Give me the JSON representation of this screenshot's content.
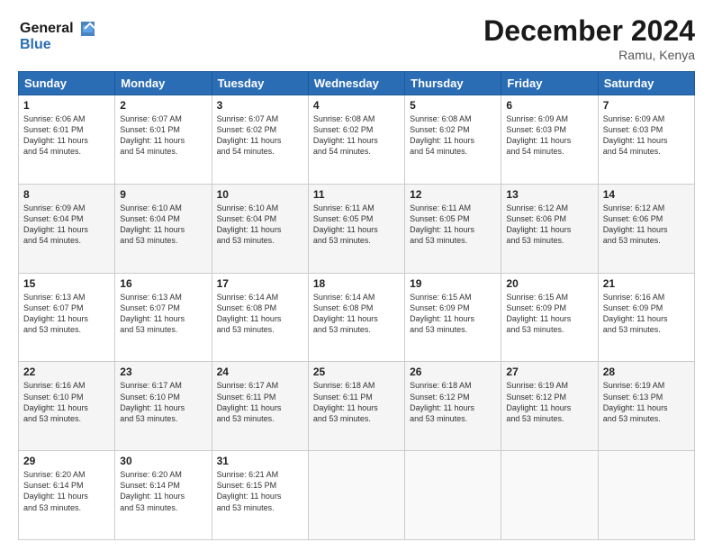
{
  "logo": {
    "line1": "General",
    "line2": "Blue"
  },
  "title": "December 2024",
  "location": "Ramu, Kenya",
  "days_of_week": [
    "Sunday",
    "Monday",
    "Tuesday",
    "Wednesday",
    "Thursday",
    "Friday",
    "Saturday"
  ],
  "weeks": [
    [
      {
        "day": "1",
        "info": "Sunrise: 6:06 AM\nSunset: 6:01 PM\nDaylight: 11 hours\nand 54 minutes."
      },
      {
        "day": "2",
        "info": "Sunrise: 6:07 AM\nSunset: 6:01 PM\nDaylight: 11 hours\nand 54 minutes."
      },
      {
        "day": "3",
        "info": "Sunrise: 6:07 AM\nSunset: 6:02 PM\nDaylight: 11 hours\nand 54 minutes."
      },
      {
        "day": "4",
        "info": "Sunrise: 6:08 AM\nSunset: 6:02 PM\nDaylight: 11 hours\nand 54 minutes."
      },
      {
        "day": "5",
        "info": "Sunrise: 6:08 AM\nSunset: 6:02 PM\nDaylight: 11 hours\nand 54 minutes."
      },
      {
        "day": "6",
        "info": "Sunrise: 6:09 AM\nSunset: 6:03 PM\nDaylight: 11 hours\nand 54 minutes."
      },
      {
        "day": "7",
        "info": "Sunrise: 6:09 AM\nSunset: 6:03 PM\nDaylight: 11 hours\nand 54 minutes."
      }
    ],
    [
      {
        "day": "8",
        "info": "Sunrise: 6:09 AM\nSunset: 6:04 PM\nDaylight: 11 hours\nand 54 minutes."
      },
      {
        "day": "9",
        "info": "Sunrise: 6:10 AM\nSunset: 6:04 PM\nDaylight: 11 hours\nand 53 minutes."
      },
      {
        "day": "10",
        "info": "Sunrise: 6:10 AM\nSunset: 6:04 PM\nDaylight: 11 hours\nand 53 minutes."
      },
      {
        "day": "11",
        "info": "Sunrise: 6:11 AM\nSunset: 6:05 PM\nDaylight: 11 hours\nand 53 minutes."
      },
      {
        "day": "12",
        "info": "Sunrise: 6:11 AM\nSunset: 6:05 PM\nDaylight: 11 hours\nand 53 minutes."
      },
      {
        "day": "13",
        "info": "Sunrise: 6:12 AM\nSunset: 6:06 PM\nDaylight: 11 hours\nand 53 minutes."
      },
      {
        "day": "14",
        "info": "Sunrise: 6:12 AM\nSunset: 6:06 PM\nDaylight: 11 hours\nand 53 minutes."
      }
    ],
    [
      {
        "day": "15",
        "info": "Sunrise: 6:13 AM\nSunset: 6:07 PM\nDaylight: 11 hours\nand 53 minutes."
      },
      {
        "day": "16",
        "info": "Sunrise: 6:13 AM\nSunset: 6:07 PM\nDaylight: 11 hours\nand 53 minutes."
      },
      {
        "day": "17",
        "info": "Sunrise: 6:14 AM\nSunset: 6:08 PM\nDaylight: 11 hours\nand 53 minutes."
      },
      {
        "day": "18",
        "info": "Sunrise: 6:14 AM\nSunset: 6:08 PM\nDaylight: 11 hours\nand 53 minutes."
      },
      {
        "day": "19",
        "info": "Sunrise: 6:15 AM\nSunset: 6:09 PM\nDaylight: 11 hours\nand 53 minutes."
      },
      {
        "day": "20",
        "info": "Sunrise: 6:15 AM\nSunset: 6:09 PM\nDaylight: 11 hours\nand 53 minutes."
      },
      {
        "day": "21",
        "info": "Sunrise: 6:16 AM\nSunset: 6:09 PM\nDaylight: 11 hours\nand 53 minutes."
      }
    ],
    [
      {
        "day": "22",
        "info": "Sunrise: 6:16 AM\nSunset: 6:10 PM\nDaylight: 11 hours\nand 53 minutes."
      },
      {
        "day": "23",
        "info": "Sunrise: 6:17 AM\nSunset: 6:10 PM\nDaylight: 11 hours\nand 53 minutes."
      },
      {
        "day": "24",
        "info": "Sunrise: 6:17 AM\nSunset: 6:11 PM\nDaylight: 11 hours\nand 53 minutes."
      },
      {
        "day": "25",
        "info": "Sunrise: 6:18 AM\nSunset: 6:11 PM\nDaylight: 11 hours\nand 53 minutes."
      },
      {
        "day": "26",
        "info": "Sunrise: 6:18 AM\nSunset: 6:12 PM\nDaylight: 11 hours\nand 53 minutes."
      },
      {
        "day": "27",
        "info": "Sunrise: 6:19 AM\nSunset: 6:12 PM\nDaylight: 11 hours\nand 53 minutes."
      },
      {
        "day": "28",
        "info": "Sunrise: 6:19 AM\nSunset: 6:13 PM\nDaylight: 11 hours\nand 53 minutes."
      }
    ],
    [
      {
        "day": "29",
        "info": "Sunrise: 6:20 AM\nSunset: 6:14 PM\nDaylight: 11 hours\nand 53 minutes."
      },
      {
        "day": "30",
        "info": "Sunrise: 6:20 AM\nSunset: 6:14 PM\nDaylight: 11 hours\nand 53 minutes."
      },
      {
        "day": "31",
        "info": "Sunrise: 6:21 AM\nSunset: 6:15 PM\nDaylight: 11 hours\nand 53 minutes."
      },
      {
        "day": "",
        "info": ""
      },
      {
        "day": "",
        "info": ""
      },
      {
        "day": "",
        "info": ""
      },
      {
        "day": "",
        "info": ""
      }
    ]
  ]
}
